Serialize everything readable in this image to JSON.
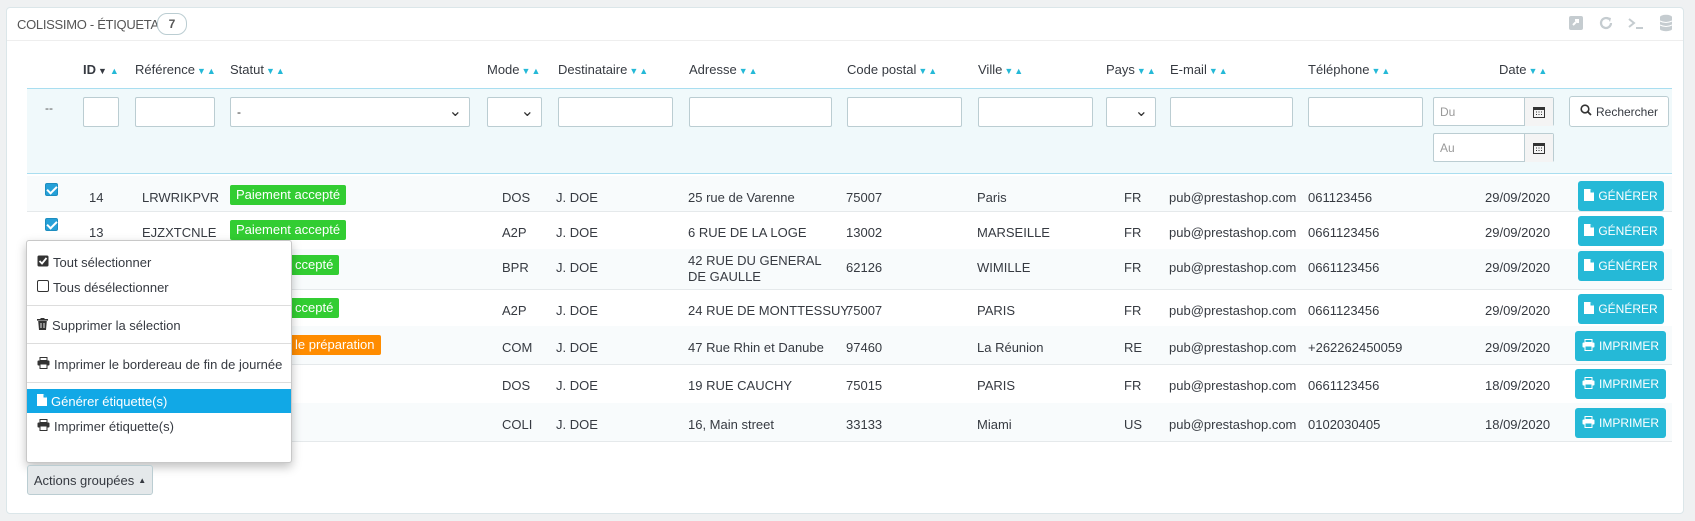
{
  "panel": {
    "title": "COLISSIMO - ÉTIQUETAGE",
    "count": "7",
    "tool_icons": [
      "export-icon",
      "refresh-icon",
      "sql-icon",
      "database-icon"
    ]
  },
  "columns": {
    "id": "ID",
    "reference": "Référence",
    "status": "Statut",
    "mode": "Mode",
    "recipient": "Destinataire",
    "address": "Adresse",
    "postcode": "Code postal",
    "city": "Ville",
    "country": "Pays",
    "email": "E-mail",
    "phone": "Téléphone",
    "date": "Date"
  },
  "filters": {
    "bulk_placeholder": "--",
    "status_value": "-",
    "date_from_placeholder": "Du",
    "date_to_placeholder": "Au",
    "search_label": "Rechercher"
  },
  "rows": [
    {
      "checked": true,
      "id": "14",
      "reference": "LRWRIKPVR",
      "status": "Paiement accepté",
      "status_color": "#32cd32",
      "mode": "DOS",
      "recipient": "J. DOE",
      "address": "25 rue de Varenne",
      "postcode": "75007",
      "city": "Paris",
      "country": "FR",
      "email": "pub@prestashop.com",
      "phone": "061123456",
      "date": "29/09/2020",
      "action": "GÉNÉRER",
      "action_icon": "file-icon"
    },
    {
      "checked": true,
      "id": "13",
      "reference": "EJZXTCNLE",
      "status": "Paiement accepté",
      "status_color": "#32cd32",
      "mode": "A2P",
      "recipient": "J. DOE",
      "address": "6 RUE DE LA LOGE",
      "postcode": "13002",
      "city": "MARSEILLE",
      "country": "FR",
      "email": "pub@prestashop.com",
      "phone": "0661123456",
      "date": "29/09/2020",
      "action": "GÉNÉRER",
      "action_icon": "file-icon"
    },
    {
      "checked": false,
      "id": "",
      "reference": "",
      "status": "ccepté",
      "status_color": "#32cd32",
      "mode": "BPR",
      "recipient": "J. DOE",
      "address": "42 RUE DU GENERAL DE GAULLE",
      "postcode": "62126",
      "city": "WIMILLE",
      "country": "FR",
      "email": "pub@prestashop.com",
      "phone": "0661123456",
      "date": "29/09/2020",
      "action": "GÉNÉRER",
      "action_icon": "file-icon"
    },
    {
      "checked": false,
      "id": "",
      "reference": "",
      "status": "ccepté",
      "status_color": "#32cd32",
      "mode": "A2P",
      "recipient": "J. DOE",
      "address": "24 RUE DE MONTTESSUY",
      "postcode": "75007",
      "city": "PARIS",
      "country": "FR",
      "email": "pub@prestashop.com",
      "phone": "0661123456",
      "date": "29/09/2020",
      "action": "GÉNÉRER",
      "action_icon": "file-icon"
    },
    {
      "checked": false,
      "id": "",
      "reference": "",
      "status": "le préparation",
      "status_color": "#ff8c00",
      "mode": "COM",
      "recipient": "J. DOE",
      "address": "47 Rue Rhin et Danube",
      "postcode": "97460",
      "city": "La Réunion",
      "country": "RE",
      "email": "pub@prestashop.com",
      "phone": "+262262450059",
      "date": "29/09/2020",
      "action": "IMPRIMER",
      "action_icon": "print-icon"
    },
    {
      "checked": false,
      "id": "",
      "reference": "",
      "status": "",
      "status_color": "",
      "mode": "DOS",
      "recipient": "J. DOE",
      "address": "19 RUE CAUCHY",
      "postcode": "75015",
      "city": "PARIS",
      "country": "FR",
      "email": "pub@prestashop.com",
      "phone": "0661123456",
      "date": "18/09/2020",
      "action": "IMPRIMER",
      "action_icon": "print-icon"
    },
    {
      "checked": false,
      "id": "",
      "reference": "",
      "status": "",
      "status_color": "",
      "mode": "COLI",
      "recipient": "J. DOE",
      "address": "16, Main street",
      "postcode": "33133",
      "city": "Miami",
      "country": "US",
      "email": "pub@prestashop.com",
      "phone": "0102030405",
      "date": "18/09/2020",
      "action": "IMPRIMER",
      "action_icon": "print-icon"
    }
  ],
  "bulk_menu": {
    "select_all": "Tout sélectionner",
    "deselect_all": "Tous désélectionner",
    "delete_selection": "Supprimer la sélection",
    "print_manifest": "Imprimer le bordereau de fin de journée",
    "generate_labels": "Générer étiquette(s)",
    "print_labels": "Imprimer étiquette(s)"
  },
  "bulk_button": "Actions groupées",
  "colors": {
    "accent": "#25b9d7",
    "menu_active": "#11a8e6",
    "status_green": "#32cd32",
    "status_orange": "#ff8c00"
  }
}
